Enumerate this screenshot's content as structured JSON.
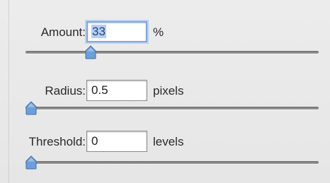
{
  "controls": [
    {
      "label": "Amount:",
      "value": "33",
      "unit": "%",
      "value_selected": true,
      "slider_fraction": 0.21
    },
    {
      "label": "Radius:",
      "value": "0.5",
      "unit": "pixels",
      "value_selected": false,
      "slider_fraction": 0.0
    },
    {
      "label": "Threshold:",
      "value": "0",
      "unit": "levels",
      "value_selected": false,
      "slider_fraction": 0.0
    }
  ],
  "colors": {
    "focus_ring": "#7ea7e3",
    "selection": "#b6cdf4",
    "thumb": "#6f9fd8"
  }
}
